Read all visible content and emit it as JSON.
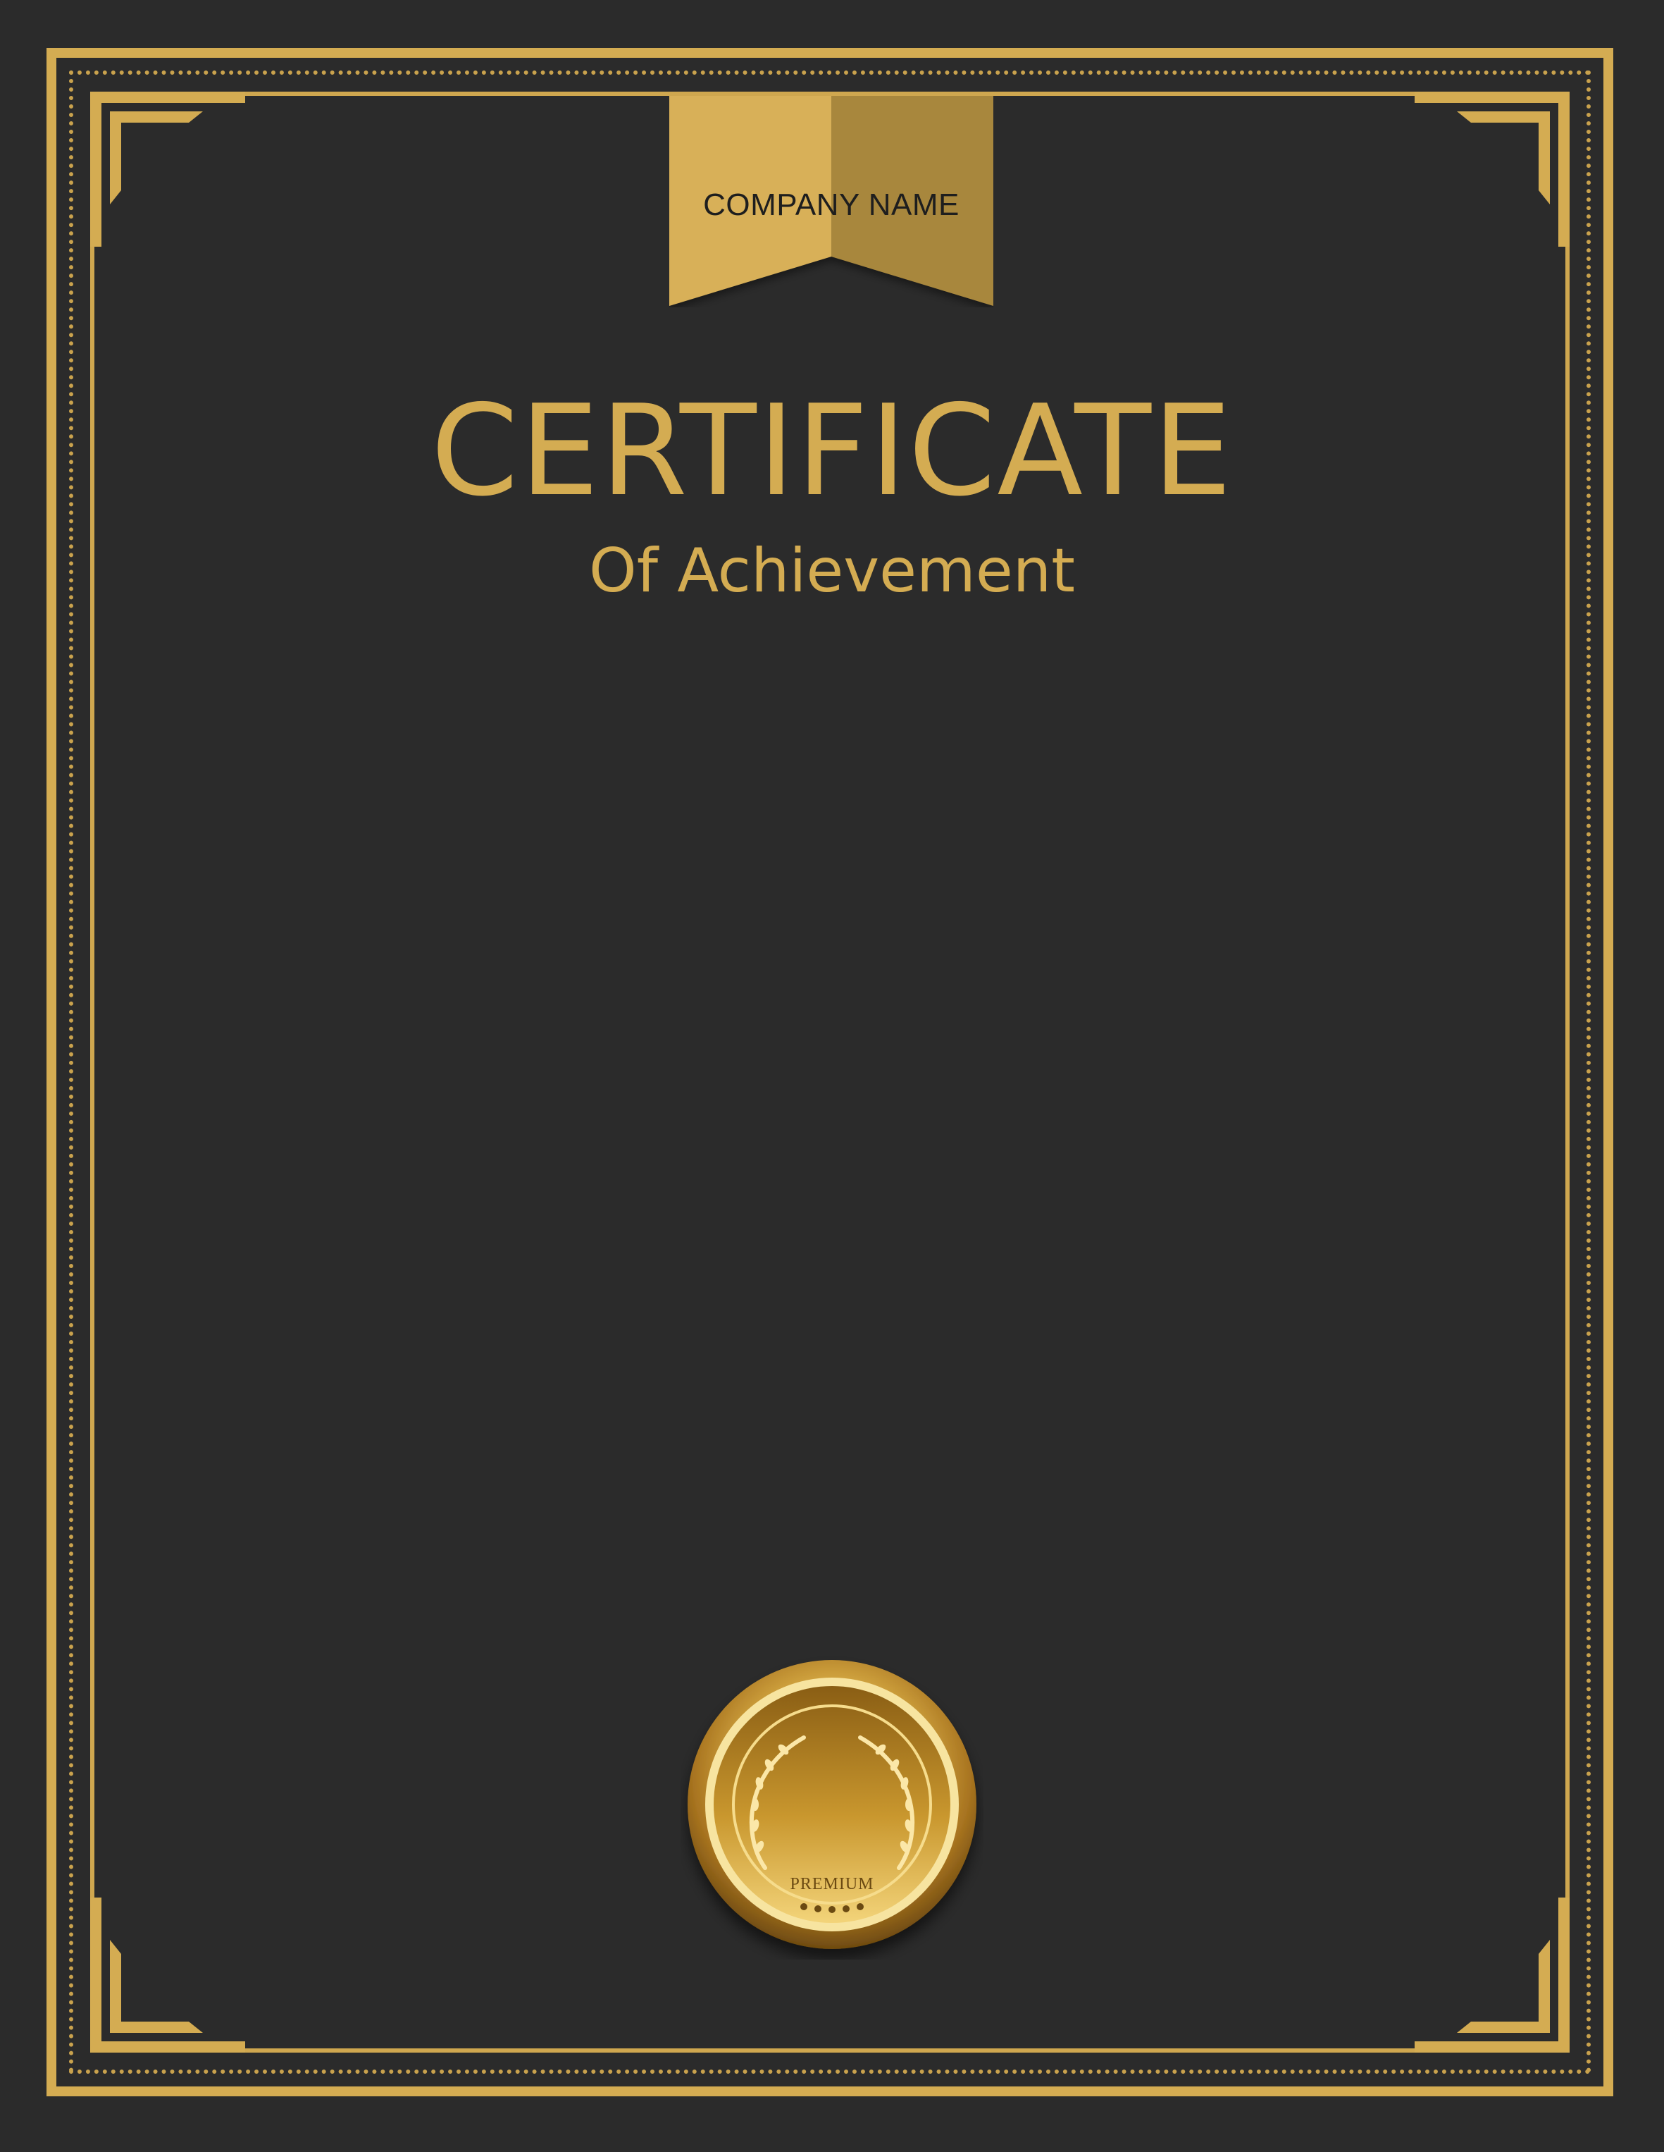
{
  "ribbon": {
    "label": "COMPANY NAME"
  },
  "certificate": {
    "title": "CERTIFICATE",
    "subtitle": "Of Achievement"
  },
  "seal": {
    "text": "PREMIUM"
  },
  "colors": {
    "background": "#2b2b2b",
    "gold": "#d4ac52",
    "gold_dark": "#a8873e"
  }
}
